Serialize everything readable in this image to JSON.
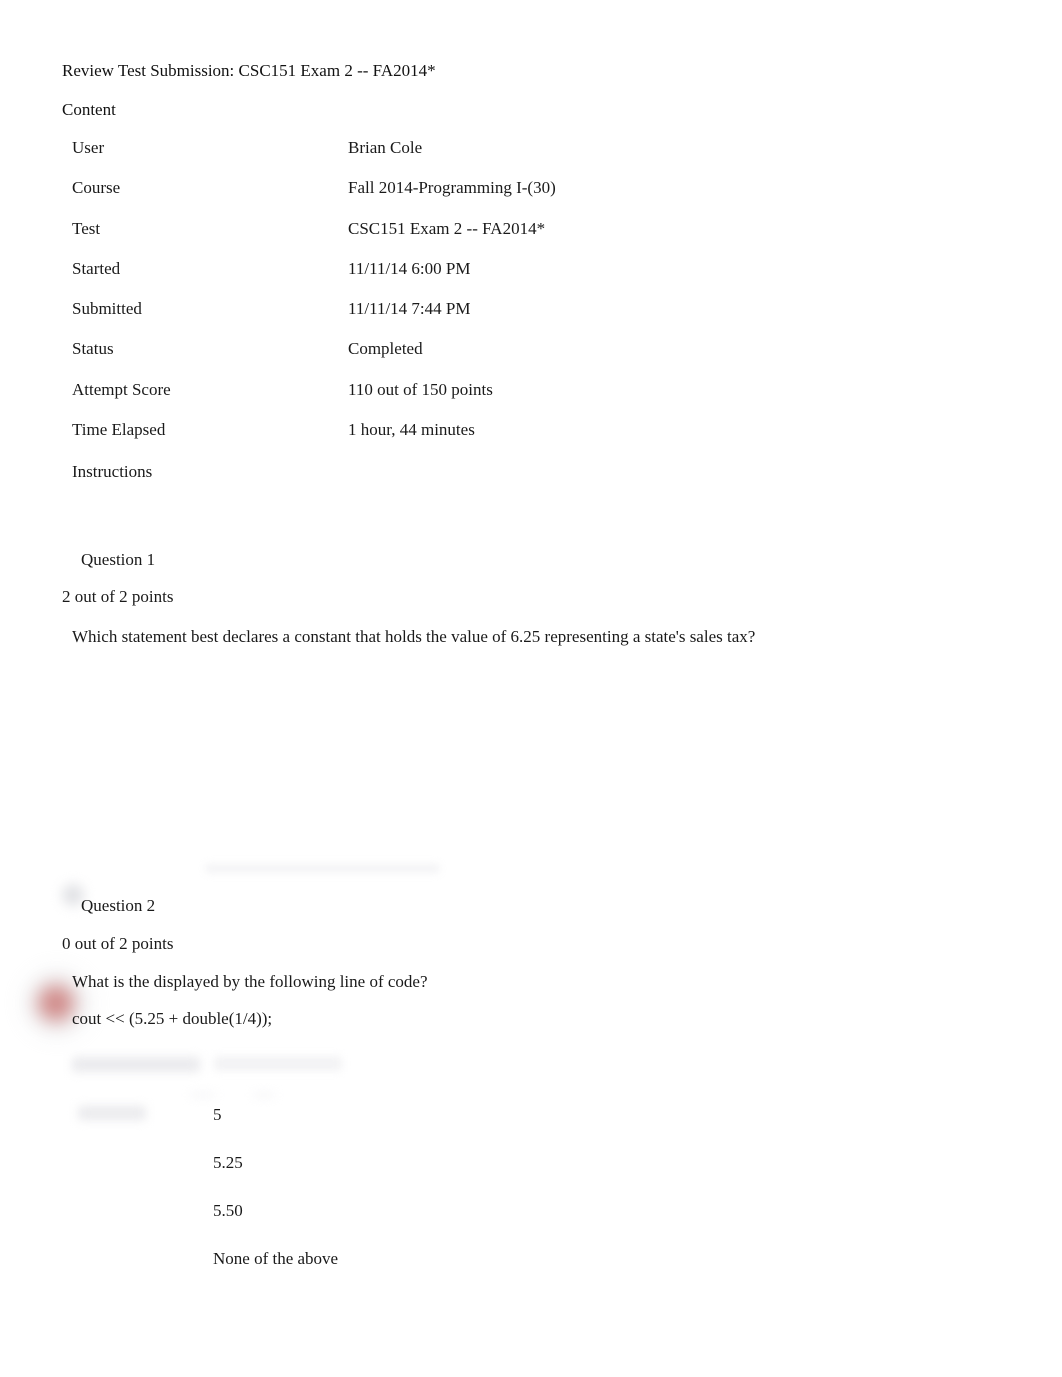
{
  "document": {
    "title": "Review Test Submission: CSC151 Exam 2 -- FA2014*",
    "content_heading": "Content"
  },
  "metadata": {
    "rows": [
      {
        "label": "User",
        "value": "Brian Cole"
      },
      {
        "label": "Course",
        "value": "Fall 2014-Programming I-(30)"
      },
      {
        "label": "Test",
        "value": "CSC151 Exam 2 -- FA2014*"
      },
      {
        "label": "Started",
        "value": "11/11/14 6:00 PM"
      },
      {
        "label": "Submitted",
        "value": "11/11/14 7:44 PM"
      },
      {
        "label": "Status",
        "value": "Completed"
      },
      {
        "label": "Attempt Score",
        "value": "110 out of 150 points"
      },
      {
        "label": "Time Elapsed",
        "value": "1 hour, 44 minutes"
      }
    ],
    "instructions_label": "Instructions"
  },
  "questions": [
    {
      "header": "Question 1",
      "points": "2 out of 2 points",
      "text": "Which statement best declares a constant that holds the value of 6.25 representing a state's sales tax?",
      "options": []
    },
    {
      "header": "Question 2",
      "points": "0 out of 2 points",
      "text": "What is the displayed by the following line of code?",
      "code": "cout << (5.25 + double(1/4));",
      "options": [
        "5",
        "5.25",
        "5.50",
        "None of the above"
      ]
    }
  ],
  "colors": {
    "page_background": "#ffffff",
    "text": "#1a1a1a",
    "redaction_grey": "#e9e9ec",
    "incorrect_marker_red": "#c0504d"
  }
}
